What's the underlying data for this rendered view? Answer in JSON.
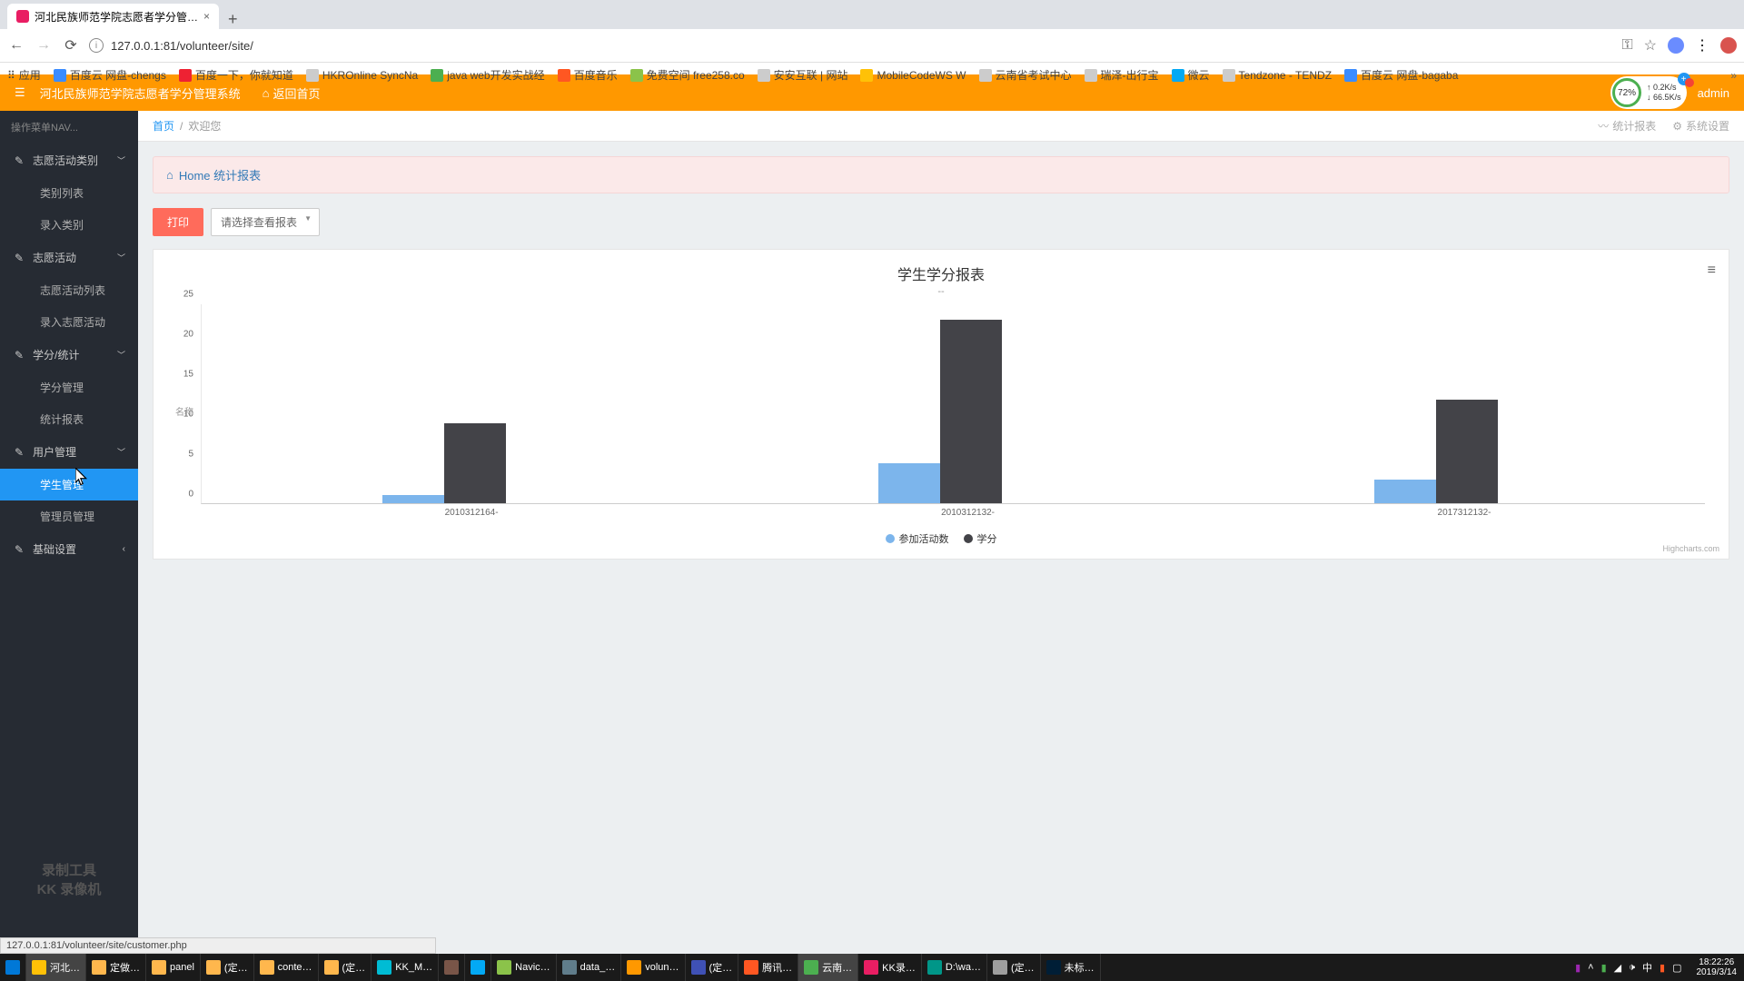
{
  "browser": {
    "tab_title": "河北民族师范学院志愿者学分管…",
    "url": "127.0.0.1:81/volunteer/site/",
    "status_url": "127.0.0.1:81/volunteer/site/customer.php",
    "bookmarks": [
      "应用",
      "百度云 网盘-chengs",
      "百度一下，你就知道",
      "HKROnline SyncNa",
      "java web开发实战经",
      "百度音乐",
      "免费空间 free258.co",
      "安安互联 | 网站",
      "MobileCodeWS W",
      "云南省考试中心",
      "瑞泽-出行宝",
      "微云",
      "Tendzone - TENDZ",
      "百度云 网盘-bagaba"
    ]
  },
  "header": {
    "title": "河北民族师范学院志愿者学分管理系统",
    "home": "返回首页",
    "admin": "admin",
    "speed": {
      "pct": "72%",
      "up": "↑  0.2K/s",
      "down": "↓ 66.5K/s"
    }
  },
  "sidebar": {
    "nav_header": "操作菜单NAV...",
    "groups": [
      {
        "label": "志愿活动类别",
        "children": [
          "类别列表",
          "录入类别"
        ]
      },
      {
        "label": "志愿活动",
        "children": [
          "志愿活动列表",
          "录入志愿活动"
        ]
      },
      {
        "label": "学分/统计",
        "children": [
          "学分管理",
          "统计报表"
        ]
      },
      {
        "label": "用户管理",
        "children": [
          "学生管理",
          "管理员管理"
        ],
        "active_child": 0
      },
      {
        "label": "基础设置",
        "collapsed": true
      }
    ],
    "watermark_1": "录制工具",
    "watermark_2": "KK 录像机"
  },
  "breadcrumb": {
    "home": "首页",
    "current": "欢迎您",
    "right": [
      "统计报表",
      "系统设置"
    ]
  },
  "banner": "Home 统计报表",
  "controls": {
    "print": "打印",
    "select_placeholder": "请选择查看报表"
  },
  "chart_data": {
    "type": "bar",
    "title": "学生学分报表",
    "subtitle": "--",
    "ylabel": "名称",
    "ylim": [
      0,
      25
    ],
    "yticks": [
      0,
      5,
      10,
      15,
      20,
      25
    ],
    "categories": [
      "2010312164-",
      "2010312132-",
      "2017312132-"
    ],
    "series": [
      {
        "name": "参加活动数",
        "color": "#7cb5ec",
        "values": [
          1,
          5,
          3
        ]
      },
      {
        "name": "学分",
        "color": "#434348",
        "values": [
          10,
          23,
          13
        ]
      }
    ],
    "credit": "Highcharts.com"
  },
  "taskbar": {
    "items": [
      "河北…",
      "定做…",
      "panel",
      "(定…",
      "conte…",
      "(定…",
      "KK_M…",
      "",
      "Navic…",
      "data_…",
      "volun…",
      "(定…",
      "腾讯…",
      "云南…",
      "KK录…",
      "D:\\wa…",
      "(定…",
      "未标…"
    ],
    "time": "18:22:26",
    "date": "2019/3/14"
  }
}
